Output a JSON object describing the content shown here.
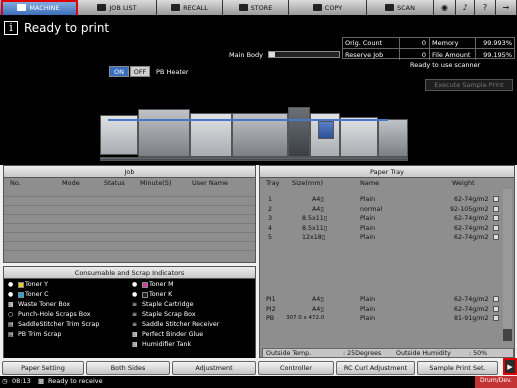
{
  "tabs": [
    {
      "label": "MACHINE",
      "icon": "machine-icon",
      "active": true
    },
    {
      "label": "JOB LIST",
      "icon": "job-list-icon",
      "active": false
    },
    {
      "label": "RECALL",
      "icon": "recall-icon",
      "active": false
    },
    {
      "label": "STORE",
      "icon": "store-icon",
      "active": false
    },
    {
      "label": "COPY",
      "icon": "copy-icon",
      "active": false
    },
    {
      "label": "SCAN",
      "icon": "scan-icon",
      "active": false
    }
  ],
  "status": {
    "title": "Ready to print",
    "main_body_label": "Main Body",
    "scanner_status": "Ready to use scanner",
    "execute_sample_label": "Execute Sample Print",
    "pb_heater": {
      "label": "PB Heater",
      "on_label": "ON",
      "off_label": "OFF",
      "state": "on"
    }
  },
  "counts": {
    "orig_count_label": "Orig. Count",
    "orig_count_value": "0",
    "memory_label": "Memory",
    "memory_value": "99.993%",
    "reserve_job_label": "Reserve Job",
    "reserve_job_value": "0",
    "file_amount_label": "File Amount",
    "file_amount_value": "99.195%"
  },
  "job": {
    "title": "Job",
    "columns": [
      "No.",
      "Mode",
      "Status",
      "Minute(S)",
      "User Name"
    ]
  },
  "consumables": {
    "title": "Consumable and Scrap Indicators",
    "left": [
      {
        "label": "Toner Y",
        "color": "#e7d21a"
      },
      {
        "label": "Toner C",
        "color": "#19a9de"
      },
      {
        "label": "Waste Toner Box",
        "color": "#ffffff"
      },
      {
        "label": "Punch-Hole Scraps Box",
        "color": "#ffffff"
      },
      {
        "label": "SaddleStitcher Trim Scrap",
        "color": "#ffffff"
      },
      {
        "label": "PB Trim Scrap",
        "color": "#ffffff"
      }
    ],
    "right": [
      {
        "label": "Toner M",
        "color": "#d63ba0"
      },
      {
        "label": "Toner K",
        "color": "#222222"
      },
      {
        "label": "Staple Cartridge",
        "color": "#ffffff"
      },
      {
        "label": "Staple Scrap Box",
        "color": "#ffffff"
      },
      {
        "label": "Saddle Stitcher Receiver",
        "color": "#ffffff"
      },
      {
        "label": "Perfect Binder Glue",
        "color": "#ffffff"
      },
      {
        "label": "Humidifier Tank",
        "color": "#ffffff"
      }
    ]
  },
  "paper_tray": {
    "title": "Paper Tray",
    "columns": [
      "Tray",
      "Size(mm)",
      "Name",
      "Weight"
    ],
    "rows": [
      {
        "tray": "1",
        "size": "A4▯",
        "name": "Plain",
        "weight": "62-74g/m2"
      },
      {
        "tray": "2",
        "size": "A4▯",
        "name": "normal",
        "weight": "92-105g/m2"
      },
      {
        "tray": "3",
        "size": "8.5x11▯",
        "name": "Plain",
        "weight": "62-74g/m2"
      },
      {
        "tray": "4",
        "size": "8.5x11▯",
        "name": "Plain",
        "weight": "62-74g/m2"
      },
      {
        "tray": "5",
        "size": "12x18▯",
        "name": "Plain",
        "weight": "62-74g/m2"
      }
    ],
    "post_rows": [
      {
        "tray": "PI1",
        "size": "A4▯",
        "name": "Plain",
        "weight": "62-74g/m2"
      },
      {
        "tray": "PI2",
        "size": "A4▯",
        "name": "Plain",
        "weight": "62-74g/m2"
      },
      {
        "tray": "PB",
        "size": "307.0 x 472.0",
        "name": "Plain",
        "weight": "81-91g/m2"
      }
    ],
    "outside_temp_label": "Outside Temp.",
    "outside_temp_value": ": 25Degrees",
    "outside_humidity_label": "Outside Humidity",
    "outside_humidity_value": ": 50%"
  },
  "buttons": {
    "paper_setting": "Paper Setting",
    "both_sides": "Both Sides",
    "adjustment": "Adjustment",
    "controller": "Controller",
    "rc_curl": "RC Curl Adjustment",
    "sample_print_set": "Sample Print Set."
  },
  "footer": {
    "time": "08:13",
    "receive_status": "Ready to receive",
    "drum": "Drum/Dev."
  }
}
